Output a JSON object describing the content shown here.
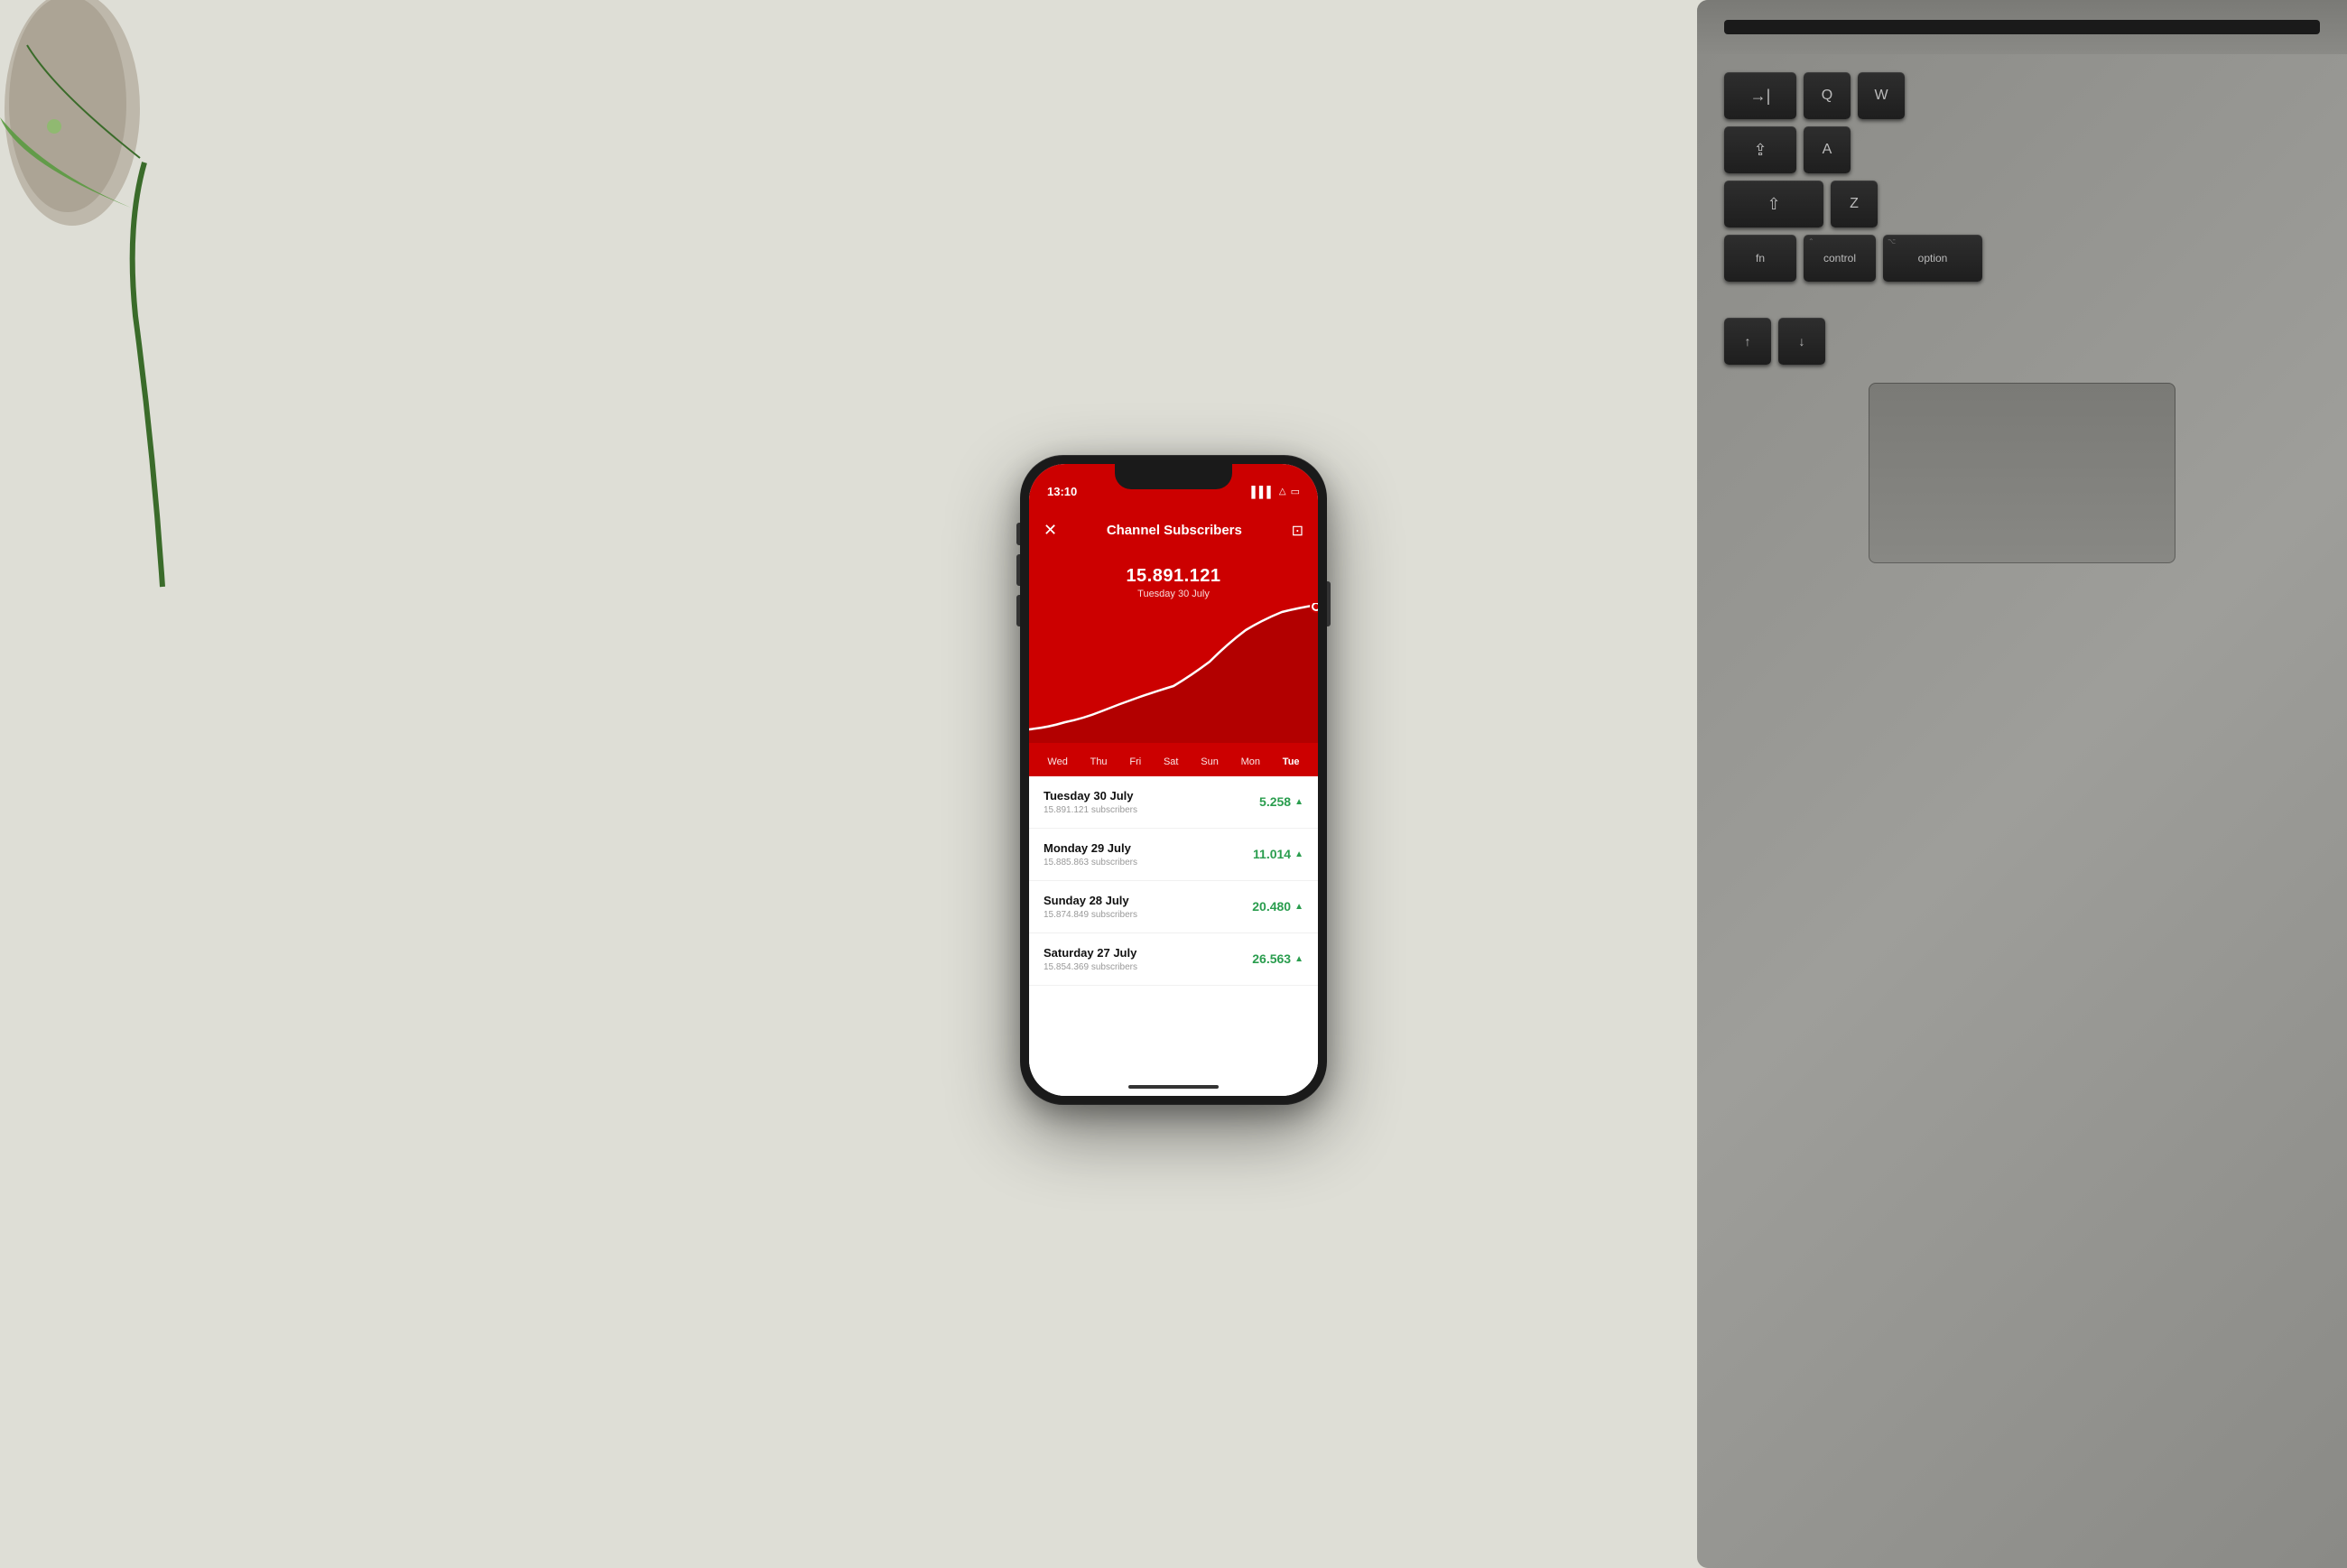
{
  "scene": {
    "bg_color": "#deded6",
    "description": "Flat lay of phone on desk with laptop keyboard visible"
  },
  "phone": {
    "status_bar": {
      "time": "13:10",
      "signal_icon": "▌▌▌",
      "wifi_icon": "wifi",
      "battery_icon": "▭"
    },
    "header": {
      "close_label": "✕",
      "title": "Channel Subscribers",
      "camera_icon": "⊡"
    },
    "stats": {
      "number": "15.891.121",
      "date": "Tuesday 30 July"
    },
    "chart": {
      "days": [
        "Wed",
        "Thu",
        "Fri",
        "Sat",
        "Sun",
        "Mon",
        "Tue"
      ],
      "active_day": "Tue",
      "bg_color": "#cc0000"
    },
    "list_items": [
      {
        "title": "Tuesday 30 July",
        "subtitle": "15.891.121 subscribers",
        "value": "5.258",
        "trend": "up"
      },
      {
        "title": "Monday 29 July",
        "subtitle": "15.885.863 subscribers",
        "value": "11.014",
        "trend": "up"
      },
      {
        "title": "Sunday 28 July",
        "subtitle": "15.874.849 subscribers",
        "value": "20.480",
        "trend": "up"
      },
      {
        "title": "Saturday 27 July",
        "subtitle": "15.854.369 subscribers",
        "value": "26.563",
        "trend": "up"
      }
    ]
  },
  "keyboard": {
    "rows": [
      [
        "→|",
        "Q",
        "W"
      ],
      [
        "⇧",
        "A"
      ],
      [
        "⇧",
        "Z"
      ],
      [
        "fn",
        "control",
        "option"
      ]
    ],
    "accent_color": "#cc0000"
  }
}
